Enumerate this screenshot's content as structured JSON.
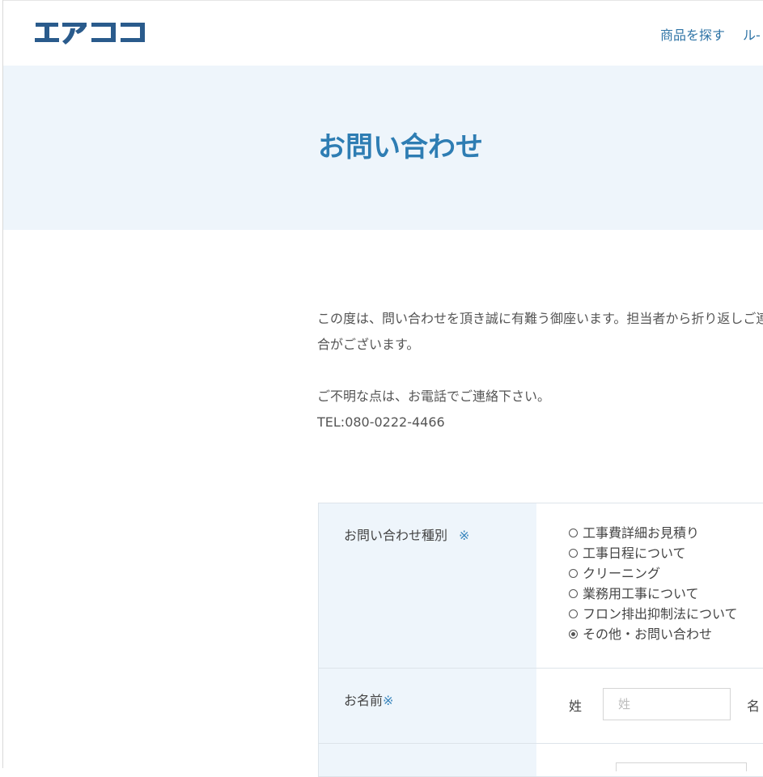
{
  "header": {
    "logo_text": "エアココ",
    "nav": [
      "商品を探す",
      "ル-"
    ]
  },
  "hero": {
    "title": "お問い合わせ"
  },
  "intro": {
    "line1": "この度は、問い合わせを頂き誠に有難う御座います。担当者から折り返しご連",
    "line2": "合がございます。",
    "line3": "ご不明な点は、お電話でご連絡下さい。",
    "line4": "TEL:080-0222-4466"
  },
  "form": {
    "inquiry_type": {
      "label": "お問い合わせ種別",
      "required_mark": "※",
      "options": [
        {
          "label": "工事費詳細お見積り",
          "checked": false
        },
        {
          "label": "工事日程について",
          "checked": false
        },
        {
          "label": "クリーニング",
          "checked": false
        },
        {
          "label": "業務用工事について",
          "checked": false
        },
        {
          "label": "フロン排出抑制法について",
          "checked": false
        },
        {
          "label": "その他・お問い合わせ",
          "checked": true
        }
      ]
    },
    "name": {
      "label": "お名前",
      "required_mark": "※",
      "last_label": "姓",
      "last_placeholder": "姓",
      "first_label": "名"
    }
  },
  "colors": {
    "accent": "#2e7db3",
    "logo": "#2a5b8c",
    "hero_bg": "#eef5fb"
  }
}
